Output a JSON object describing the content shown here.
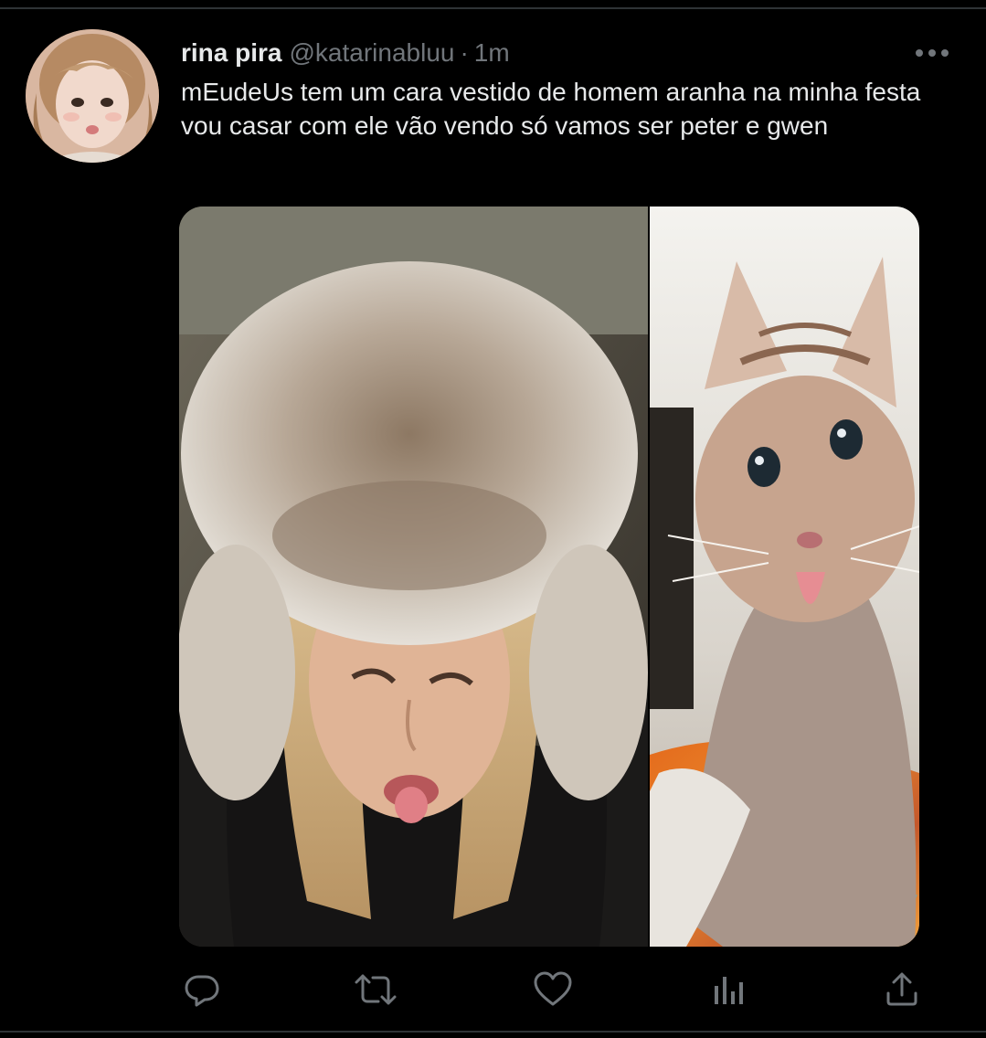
{
  "tweet": {
    "display_name": "rina pira",
    "handle": "@katarinabluu",
    "separator": "·",
    "timestamp": "1m",
    "text": "mEudeUs tem um cara vestido de homem aranha na minha festa vou casar com ele vão vendo só vamos ser peter e gwen"
  },
  "media": {
    "images": [
      {
        "subject": "woman-in-fur-hat-sticking-out-tongue"
      },
      {
        "subject": "kitten-sticking-out-tongue"
      }
    ]
  },
  "actions": [
    {
      "name": "reply",
      "icon": "reply-icon"
    },
    {
      "name": "retweet",
      "icon": "retweet-icon"
    },
    {
      "name": "like",
      "icon": "heart-icon"
    },
    {
      "name": "analytics",
      "icon": "analytics-icon"
    },
    {
      "name": "share",
      "icon": "share-icon"
    }
  ],
  "colors": {
    "background": "#000000",
    "text_primary": "#e7e9ea",
    "text_secondary": "#71767b",
    "border": "#2f3336"
  }
}
